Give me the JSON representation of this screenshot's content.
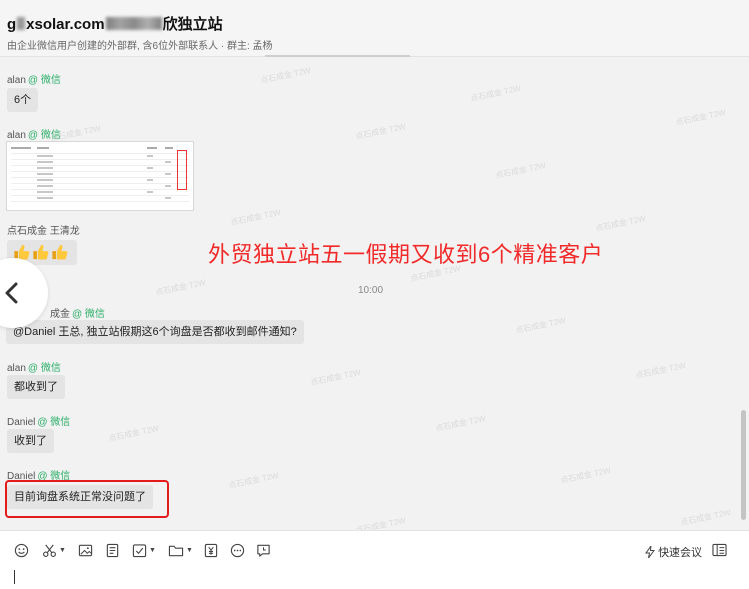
{
  "header": {
    "title_start": "g",
    "title_mid": "xsolar.com",
    "title_end": "欣独立站",
    "subtitle": "由企业微信用户创建的外部群, 含6位外部联系人 · 群主: 孟杨"
  },
  "watermark_text": "点石成金 T2W",
  "messages": [
    {
      "sender": "alan",
      "tag": "@ 微信",
      "text": "6个"
    },
    {
      "sender": "alan",
      "tag": "@ 微信"
    },
    {
      "sender": "点石成金 王清龙",
      "tag": ""
    },
    {
      "sender": "成金",
      "tag": "@ 微信",
      "text": "@Daniel  王总, 独立站假期这6个询盘是否都收到邮件通知?"
    },
    {
      "sender": "alan",
      "tag": "@ 微信",
      "text": "都收到了"
    },
    {
      "sender": "Daniel",
      "tag": "@ 微信",
      "text": "收到了"
    },
    {
      "sender": "Daniel",
      "tag": "@ 微信",
      "text": "目前询盘系统正常没问题了"
    }
  ],
  "time_divider": "10:00",
  "annotation": "外贸独立站五一假期又收到6个精准客户",
  "composer": {
    "meeting_label": "快速会议"
  },
  "colors": {
    "wechat_tag": "#2aae67",
    "annotation": "#f12929",
    "highlight": "#e31b1b"
  },
  "icons": [
    "emoji-icon",
    "scissors-icon",
    "image-icon",
    "file-icon",
    "todo-icon",
    "folder-icon",
    "money-icon",
    "more-icon",
    "chat-record-icon",
    "lightning-icon",
    "sidebar-icon",
    "back-arrow-icon",
    "thumbs-up-icon"
  ]
}
